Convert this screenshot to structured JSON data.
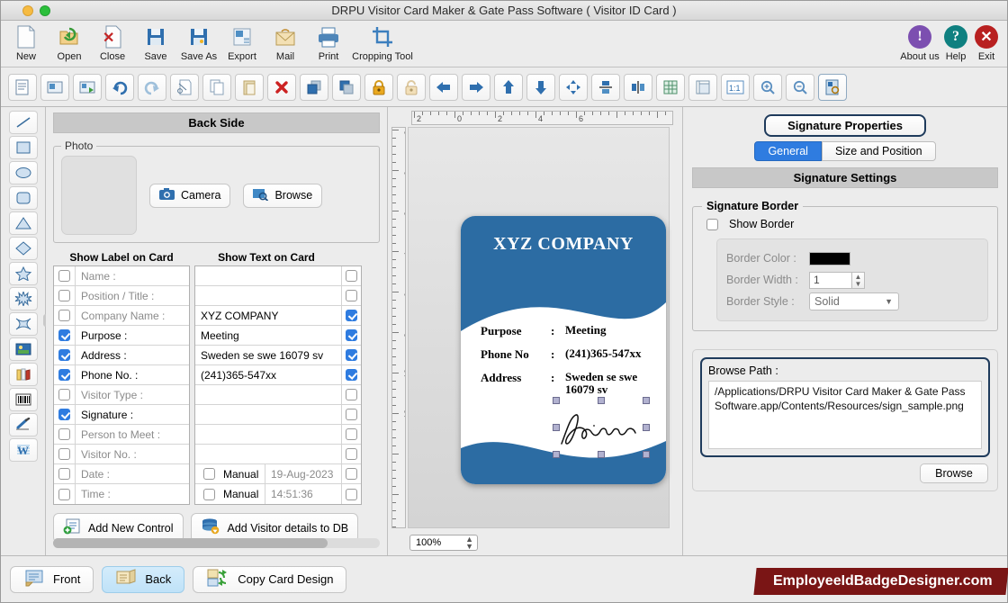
{
  "window": {
    "title": "DRPU Visitor Card Maker & Gate Pass Software ( Visitor ID Card )"
  },
  "file_toolbar": {
    "items": [
      {
        "label": "New",
        "icon": "new-document-icon"
      },
      {
        "label": "Open",
        "icon": "open-folder-icon"
      },
      {
        "label": "Close",
        "icon": "close-document-icon"
      },
      {
        "label": "Save",
        "icon": "save-floppy-icon"
      },
      {
        "label": "Save As",
        "icon": "save-as-floppy-icon"
      },
      {
        "label": "Export",
        "icon": "export-image-icon"
      },
      {
        "label": "Mail",
        "icon": "mail-envelope-icon"
      },
      {
        "label": "Print",
        "icon": "printer-icon"
      },
      {
        "label": "Cropping Tool",
        "icon": "crop-icon"
      }
    ],
    "right_items": [
      {
        "label": "About us",
        "icon": "info-circle-icon",
        "color": "#7c4fb0"
      },
      {
        "label": "Help",
        "icon": "question-circle-icon",
        "color": "#0f8080"
      },
      {
        "label": "Exit",
        "icon": "close-circle-icon",
        "color": "#b82020"
      }
    ]
  },
  "icon_toolbar": {
    "items": [
      "text-document-icon",
      "add-image-icon",
      "export-image-icon",
      "undo-icon",
      "redo-icon",
      "cut-icon",
      "copy-icon",
      "paste-icon",
      "delete-icon",
      "bring-front-icon",
      "send-back-icon",
      "lock-icon",
      "unlock-icon",
      "align-left-icon",
      "align-right-icon",
      "align-top-icon",
      "align-bottom-icon",
      "center-both-icon",
      "center-vertical-icon",
      "center-horizontal-icon",
      "grid-icon",
      "ruler-icon",
      "actual-size-icon",
      "zoom-in-icon",
      "zoom-out-icon",
      "card-preview-icon"
    ]
  },
  "tool_palette": {
    "items": [
      "line-tool-icon",
      "rectangle-tool-icon",
      "ellipse-tool-icon",
      "rounded-rect-tool-icon",
      "triangle-tool-icon",
      "diamond-tool-icon",
      "star-tool-icon",
      "starburst-tool-icon",
      "four-point-star-tool-icon",
      "image-tool-icon",
      "books-tool-icon",
      "barcode-tool-icon",
      "signature-tool-icon",
      "watermark-tool-icon"
    ]
  },
  "left_panel": {
    "header": "Back Side",
    "photo_group_title": "Photo",
    "camera_button": "Camera",
    "browse_button": "Browse",
    "col_label_header": "Show Label on Card",
    "col_text_header": "Show Text on Card",
    "rows": [
      {
        "label": "Name :",
        "label_checked": false,
        "value": "",
        "value_checked": false
      },
      {
        "label": "Position / Title :",
        "label_checked": false,
        "value": "",
        "value_checked": false
      },
      {
        "label": "Company Name :",
        "label_checked": false,
        "value": "XYZ COMPANY",
        "value_checked": true
      },
      {
        "label": "Purpose :",
        "label_checked": true,
        "value": "Meeting",
        "value_checked": true
      },
      {
        "label": "Address :",
        "label_checked": true,
        "value": "Sweden se swe 16079 sv",
        "value_checked": true
      },
      {
        "label": "Phone No. :",
        "label_checked": true,
        "value": "(241)365-547xx",
        "value_checked": true
      },
      {
        "label": "Visitor Type :",
        "label_checked": false,
        "value": "",
        "value_checked": false
      },
      {
        "label": "Signature :",
        "label_checked": true,
        "value": "",
        "value_checked": false
      },
      {
        "label": "Person to Meet :",
        "label_checked": false,
        "value": "",
        "value_checked": false
      },
      {
        "label": "Visitor No. :",
        "label_checked": false,
        "value": "",
        "value_checked": false
      },
      {
        "label": "Date :",
        "label_checked": false,
        "value": "19-Aug-2023",
        "value_checked": false,
        "manual_label": "Manual",
        "manual_checked": false
      },
      {
        "label": "Time :",
        "label_checked": false,
        "value": "14:51:36",
        "value_checked": false,
        "manual_label": "Manual",
        "manual_checked": false
      }
    ],
    "add_new_control": "Add New Control",
    "add_visitor_db": "Add Visitor details to DB"
  },
  "canvas": {
    "zoom": "100%",
    "ruler_h_ticks": [
      "2",
      "0",
      "2",
      "4",
      "6"
    ],
    "ruler_v_ticks": [
      "2",
      "0",
      "2",
      "4",
      "6",
      "8",
      "10",
      "12"
    ],
    "card": {
      "company": "XYZ COMPANY",
      "accent_color": "#2c6ca3",
      "lines": [
        {
          "key": "Purpose",
          "sep": ":",
          "value": "Meeting"
        },
        {
          "key": "Phone No",
          "sep": ":",
          "value": "(241)365-547xx"
        },
        {
          "key": "Address",
          "sep": ":",
          "value": "Sweden se swe 16079 sv"
        }
      ],
      "signature_alt": "M. Curie"
    }
  },
  "right_panel": {
    "properties_title": "Signature Properties",
    "tabs": [
      {
        "label": "General",
        "active": true
      },
      {
        "label": "Size and Position",
        "active": false
      }
    ],
    "section_header": "Signature Settings",
    "border_group_title": "Signature Border",
    "show_border_label": "Show Border",
    "show_border_checked": false,
    "border_color_label": "Border Color :",
    "border_color_value": "#000000",
    "border_width_label": "Border Width :",
    "border_width_value": "1",
    "border_style_label": "Border Style :",
    "border_style_value": "Solid",
    "browse_path_label": "Browse Path :",
    "browse_path_value": "/Applications/DRPU Visitor Card Maker & Gate Pass Software.app/Contents/Resources/sign_sample.png",
    "browse_button": "Browse"
  },
  "bottom_bar": {
    "front": "Front",
    "back": "Back",
    "copy_card_design": "Copy Card Design",
    "brand": "EmployeeIdBadgeDesigner.com"
  }
}
